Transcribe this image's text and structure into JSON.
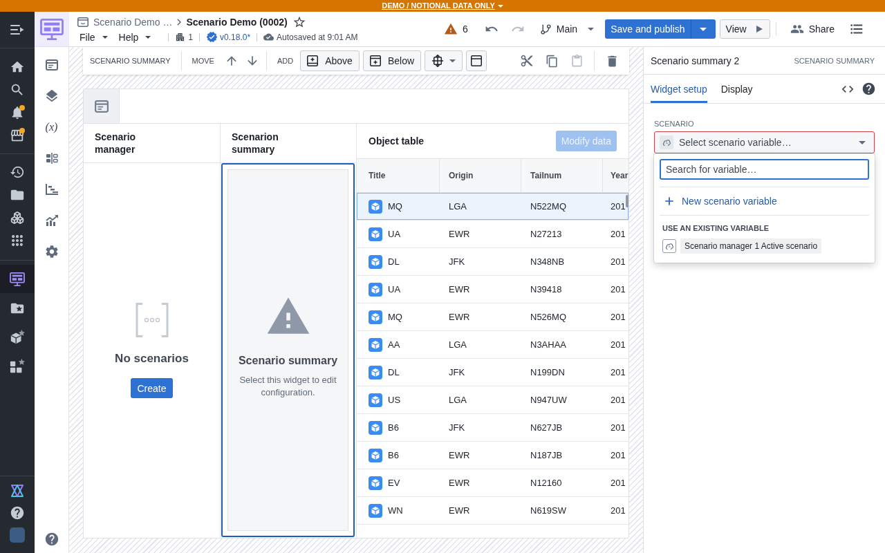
{
  "banner": {
    "text": "DEMO / NOTIONAL DATA ONLY"
  },
  "nav_rail": {
    "groups": [
      [
        {
          "kind": "menu",
          "selected": false,
          "notification": false
        }
      ],
      [
        {
          "kind": "home",
          "selected": false,
          "notification": false
        },
        {
          "kind": "search",
          "selected": false,
          "notification": false
        },
        {
          "kind": "bell",
          "selected": false,
          "notification": true
        },
        {
          "kind": "store",
          "selected": false,
          "notification": true
        }
      ],
      [
        {
          "kind": "history",
          "selected": false,
          "notification": false
        },
        {
          "kind": "folder",
          "selected": false,
          "notification": false
        },
        {
          "kind": "objects",
          "selected": false,
          "notification": false
        },
        {
          "kind": "apps",
          "selected": false,
          "notification": false
        }
      ],
      [
        {
          "kind": "dashboard",
          "selected": true,
          "notification": false
        },
        {
          "kind": "folder-star",
          "selected": false,
          "notification": false
        },
        {
          "kind": "cube-star",
          "selected": false,
          "notification": false
        },
        {
          "kind": "grid-star",
          "selected": false,
          "notification": false
        }
      ]
    ],
    "bottom": [
      {
        "kind": "logo",
        "selected": false,
        "notification": false
      },
      {
        "kind": "help",
        "selected": false,
        "notification": false
      },
      {
        "kind": "avatar",
        "selected": false,
        "notification": false
      }
    ]
  },
  "tool_sidebar": {
    "items": [
      {
        "kind": "window"
      },
      {
        "kind": "layers"
      },
      {
        "kind": "glyph",
        "text": "(x)"
      },
      {
        "kind": "align"
      },
      {
        "kind": "gantt"
      },
      {
        "kind": "chart"
      },
      {
        "kind": "settings"
      }
    ],
    "footer": [
      {
        "kind": "help"
      }
    ]
  },
  "header": {
    "breadcrumb_parent": "Scenario Demo …",
    "title": "Scenario Demo (0002)",
    "starred": false,
    "menus": [
      "File",
      "Help"
    ],
    "project_count": "1",
    "version": "v0.18.0*",
    "autosave": "Autosaved at 9:01 AM",
    "warning_count": "6",
    "undo_disabled": false,
    "redo_disabled": true,
    "branch": "Main",
    "publish_button": "Save and publish",
    "view_button": "View",
    "share_button": "Share"
  },
  "toolbar": {
    "widget_type": "SCENARIO SUMMARY",
    "move_label": "MOVE",
    "add_label": "ADD",
    "add_buttons": [
      {
        "kind": "above",
        "label": "Above"
      },
      {
        "kind": "below",
        "label": "Below"
      }
    ],
    "actions": [
      {
        "kind": "cut",
        "disabled": false
      },
      {
        "kind": "copy",
        "disabled": false
      },
      {
        "kind": "paste",
        "disabled": true
      },
      {
        "kind": "delete",
        "disabled": false
      }
    ]
  },
  "canvas": {
    "scenario_manager": {
      "title": "Scenario manager",
      "empty_title": "No scenarios",
      "create_button": "Create"
    },
    "scenario_summary": {
      "title": "Scenarion summary",
      "selected": true,
      "heading": "Scenario summary",
      "hint": "Select this widget to edit configuration."
    },
    "object_table": {
      "title": "Object table",
      "action": {
        "label": "Modify data",
        "disabled": true
      },
      "columns": [
        "Title",
        "Origin",
        "Tailnum",
        "Year"
      ],
      "rows": [
        {
          "cells": [
            "MQ",
            "LGA",
            "N522MQ",
            "201"
          ],
          "selected": true
        },
        {
          "cells": [
            "UA",
            "EWR",
            "N27213",
            "201"
          ],
          "selected": false
        },
        {
          "cells": [
            "DL",
            "JFK",
            "N348NB",
            "201"
          ],
          "selected": false
        },
        {
          "cells": [
            "UA",
            "EWR",
            "N39418",
            "201"
          ],
          "selected": false
        },
        {
          "cells": [
            "MQ",
            "EWR",
            "N526MQ",
            "201"
          ],
          "selected": false
        },
        {
          "cells": [
            "AA",
            "LGA",
            "N3AHAA",
            "201"
          ],
          "selected": false
        },
        {
          "cells": [
            "DL",
            "JFK",
            "N199DN",
            "201"
          ],
          "selected": false
        },
        {
          "cells": [
            "US",
            "LGA",
            "N947UW",
            "201"
          ],
          "selected": false
        },
        {
          "cells": [
            "B6",
            "JFK",
            "N627JB",
            "201"
          ],
          "selected": false
        },
        {
          "cells": [
            "B6",
            "EWR",
            "N187JB",
            "201"
          ],
          "selected": false
        },
        {
          "cells": [
            "EV",
            "EWR",
            "N12160",
            "201"
          ],
          "selected": false
        },
        {
          "cells": [
            "WN",
            "EWR",
            "N619SW",
            "201"
          ],
          "selected": false
        }
      ]
    }
  },
  "inspector": {
    "title": "Scenario summary 2",
    "widget_type": "SCENARIO SUMMARY",
    "tabs": [
      {
        "label": "Widget setup",
        "selected": true
      },
      {
        "label": "Display",
        "selected": false
      }
    ],
    "field_label": "SCENARIO",
    "select": {
      "placeholder": "Select scenario variable…",
      "invalid": true,
      "expanded": true
    },
    "menu": {
      "search_placeholder": "Search for variable…",
      "create_option": "New scenario variable",
      "section_title": "USE AN EXISTING VARIABLE",
      "options": [
        {
          "label": "Scenario manager 1 Active scenario",
          "selected": false
        }
      ]
    }
  }
}
